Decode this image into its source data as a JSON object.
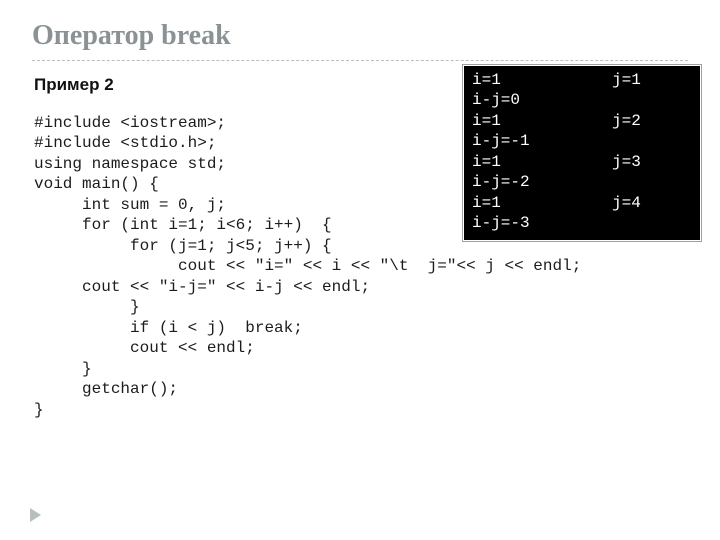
{
  "title": "Оператор break",
  "subtitle": "Пример 2",
  "code_lines": [
    "#include <iostream>;",
    "#include <stdio.h>;",
    "using namespace std;",
    "void main() {",
    "     int sum = 0, j;",
    "     for (int i=1; i<6; i++)  {",
    "          for (j=1; j<5; j++) {",
    "               cout << \"i=\" << i << \"\\t  j=\"<< j << endl;",
    "     cout << \"i-j=\" << i-j << endl;",
    "          }",
    "          if (i < j)  break;",
    "          cout << endl;",
    "     }",
    "     getchar();",
    "}"
  ],
  "output_rows": [
    {
      "left": "i=1",
      "right": "j=1"
    },
    {
      "left": "i-j=0",
      "right": ""
    },
    {
      "left": "i=1",
      "right": "j=2"
    },
    {
      "left": "i-j=-1",
      "right": ""
    },
    {
      "left": "i=1",
      "right": "j=3"
    },
    {
      "left": "i-j=-2",
      "right": ""
    },
    {
      "left": "i=1",
      "right": "j=4"
    },
    {
      "left": "i-j=-3",
      "right": ""
    }
  ]
}
